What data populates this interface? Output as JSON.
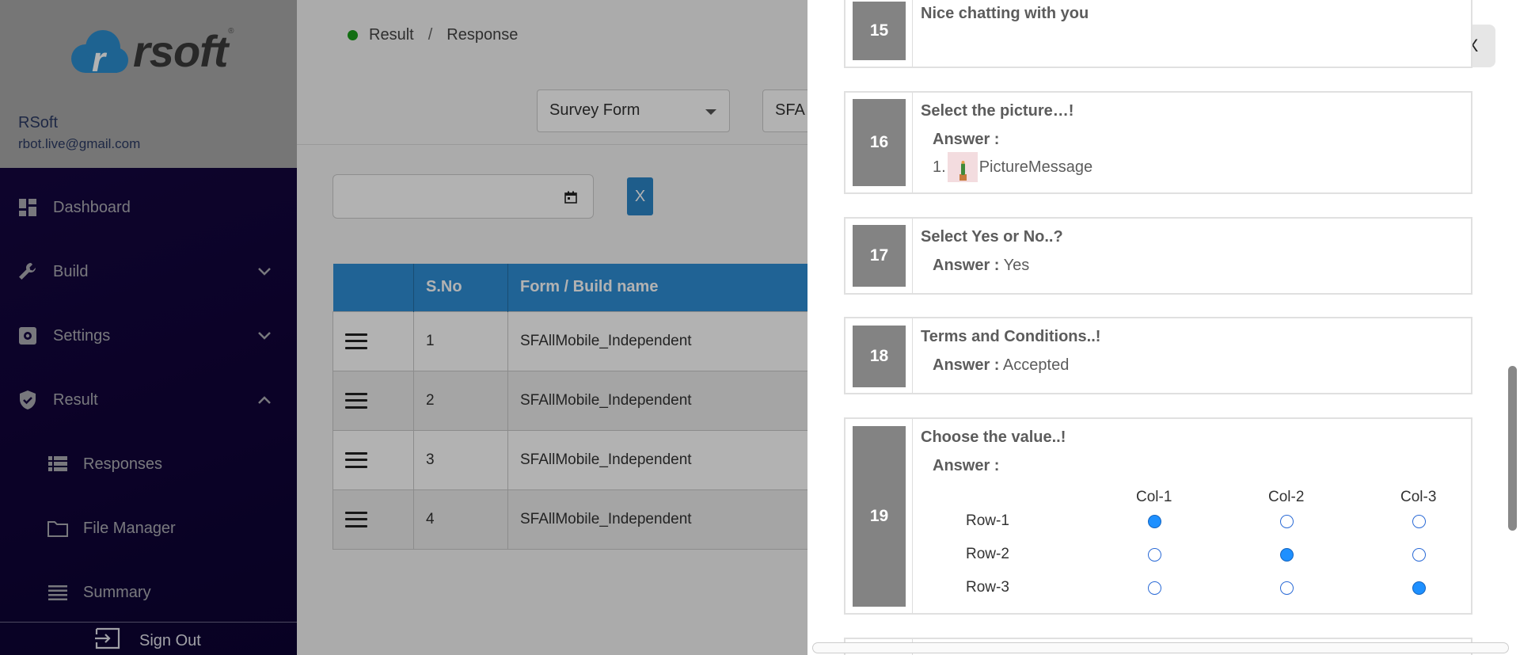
{
  "brand": {
    "logo_text": "rsoft",
    "logo_mark": "r",
    "registered": "®"
  },
  "user": {
    "name": "RSoft",
    "email": "rbot.live@gmail.com"
  },
  "nav": {
    "dashboard": "Dashboard",
    "build": "Build",
    "settings": "Settings",
    "result": "Result",
    "responses": "Responses",
    "file_manager": "File Manager",
    "summary": "Summary",
    "sign_out": "Sign Out"
  },
  "breadcrumb": {
    "first": "Result",
    "separator": "/",
    "second": "Response"
  },
  "filters": {
    "form_type": "Survey Form",
    "form_name": "SFA"
  },
  "clear_button": "X",
  "table": {
    "headers": [
      "",
      "S.No",
      "Form / Build name"
    ],
    "rows": [
      {
        "sno": "1",
        "name": "SFAllMobile_Independent"
      },
      {
        "sno": "2",
        "name": "SFAllMobile_Independent"
      },
      {
        "sno": "3",
        "name": "SFAllMobile_Independent"
      },
      {
        "sno": "4",
        "name": "SFAllMobile_Independent"
      }
    ]
  },
  "drawer": {
    "close_label": "X",
    "answer_label": "Answer :",
    "questions": [
      {
        "num": "15",
        "title": "Nice chatting with you"
      },
      {
        "num": "16",
        "title": "Select the picture…!",
        "answer_index": "1.",
        "answer": "PictureMessage"
      },
      {
        "num": "17",
        "title": "Select Yes or No..?",
        "answer": "Yes"
      },
      {
        "num": "18",
        "title": "Terms and Conditions..!",
        "answer": "Accepted"
      },
      {
        "num": "19",
        "title": "Choose the value..!",
        "grid": {
          "columns": [
            "Col-1",
            "Col-2",
            "Col-3"
          ],
          "rows": [
            "Row-1",
            "Row-2",
            "Row-3"
          ],
          "selected": [
            0,
            1,
            2
          ]
        }
      }
    ]
  }
}
